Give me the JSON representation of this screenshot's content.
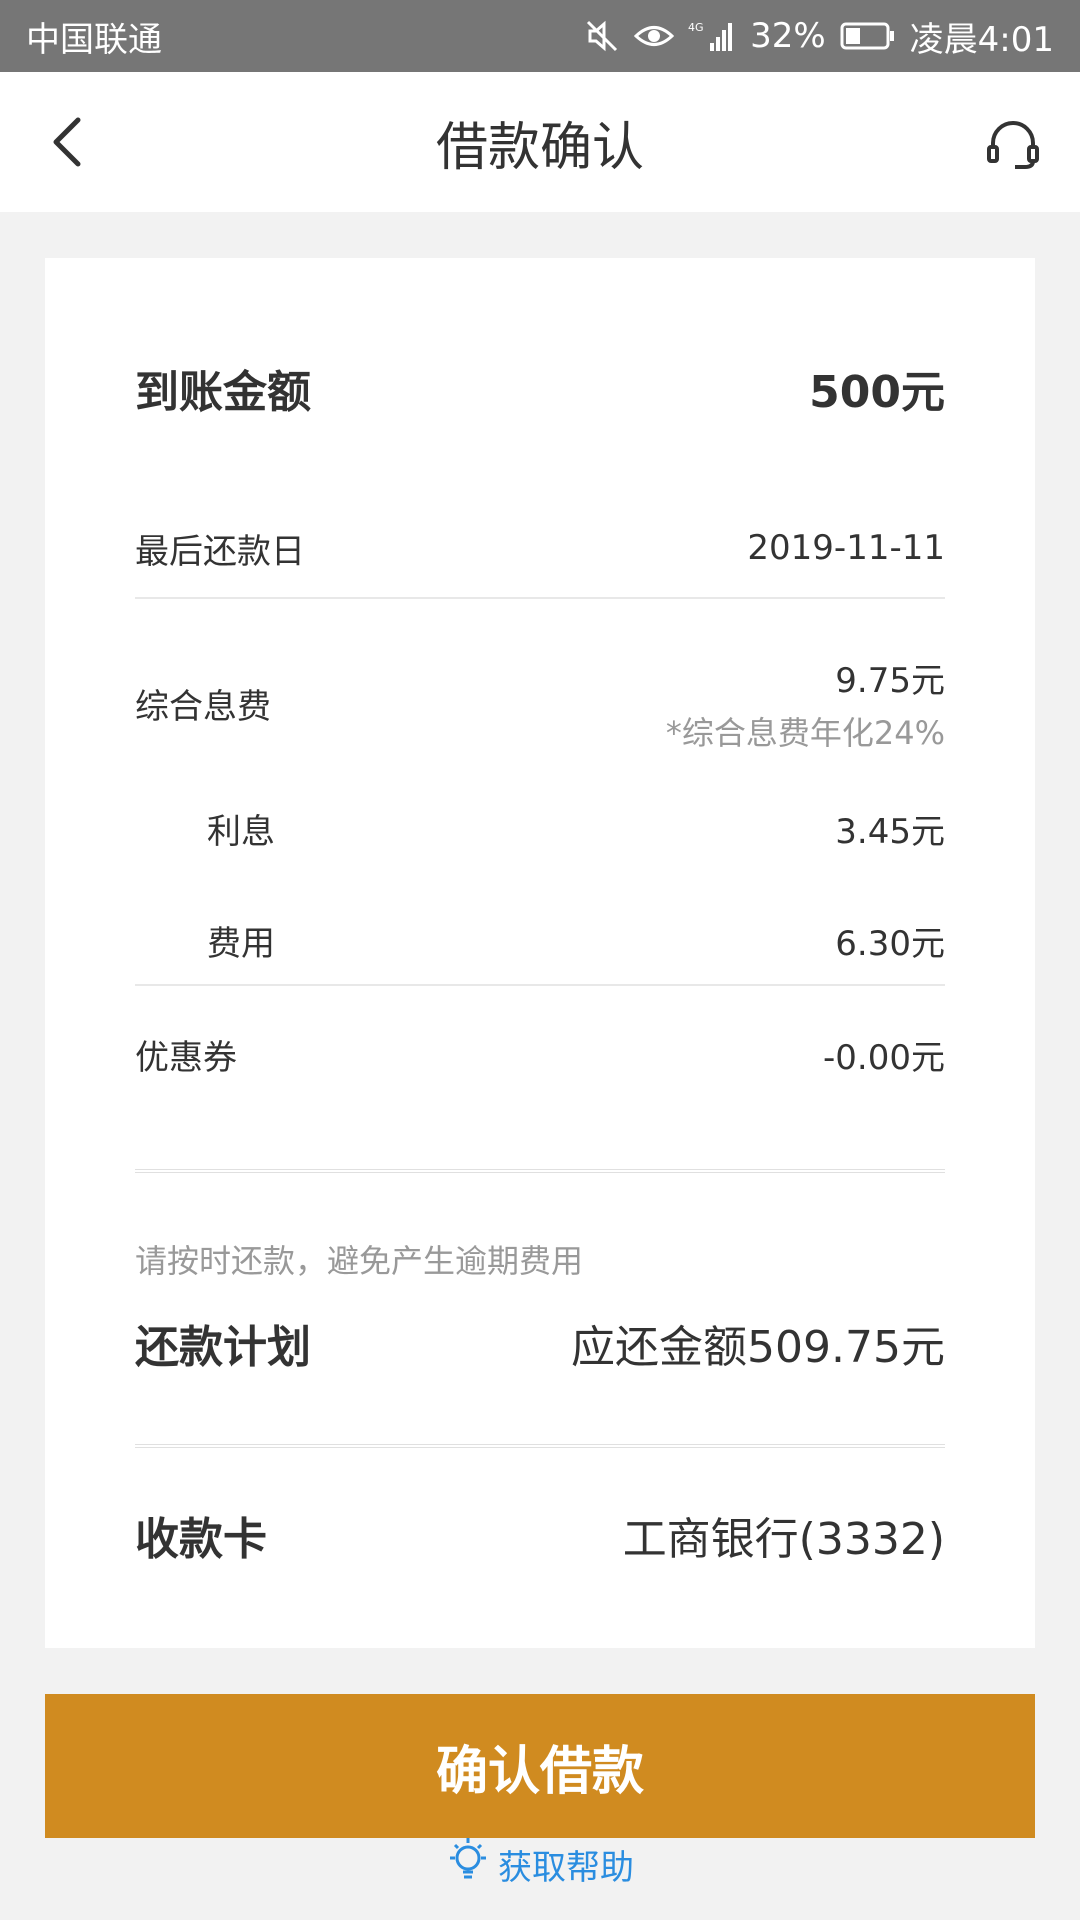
{
  "status_bar": {
    "carrier": "中国联通",
    "network": "4G",
    "battery": "32%",
    "time": "凌晨4:01"
  },
  "nav": {
    "title": "借款确认",
    "back_icon": "chevron-left-icon",
    "service_icon": "headset-icon"
  },
  "summary": {
    "amount_label": "到账金额",
    "amount_value": "500元",
    "due_label": "最后还款日",
    "due_value": "2019-11-11",
    "fee_label": "综合息费",
    "fee_value": "9.75元",
    "fee_note": "*综合息费年化24%",
    "interest_label": "利息",
    "interest_value": "3.45元",
    "cost_label": "费用",
    "cost_value": "6.30元",
    "coupon_label": "优惠券",
    "coupon_value": "-0.00元"
  },
  "repayment": {
    "reminder": "请按时还款，避免产生逾期费用",
    "plan_label": "还款计划",
    "plan_value": "应还金额509.75元"
  },
  "card": {
    "label": "收款卡",
    "value": "工商银行(3332)"
  },
  "actions": {
    "confirm_label": "确认借款",
    "help_label": "获取帮助",
    "help_icon": "lightbulb-icon"
  },
  "colors": {
    "accent": "#d08b20",
    "link": "#2a8de0",
    "status_bar": "#767676",
    "background": "#f2f2f2"
  }
}
